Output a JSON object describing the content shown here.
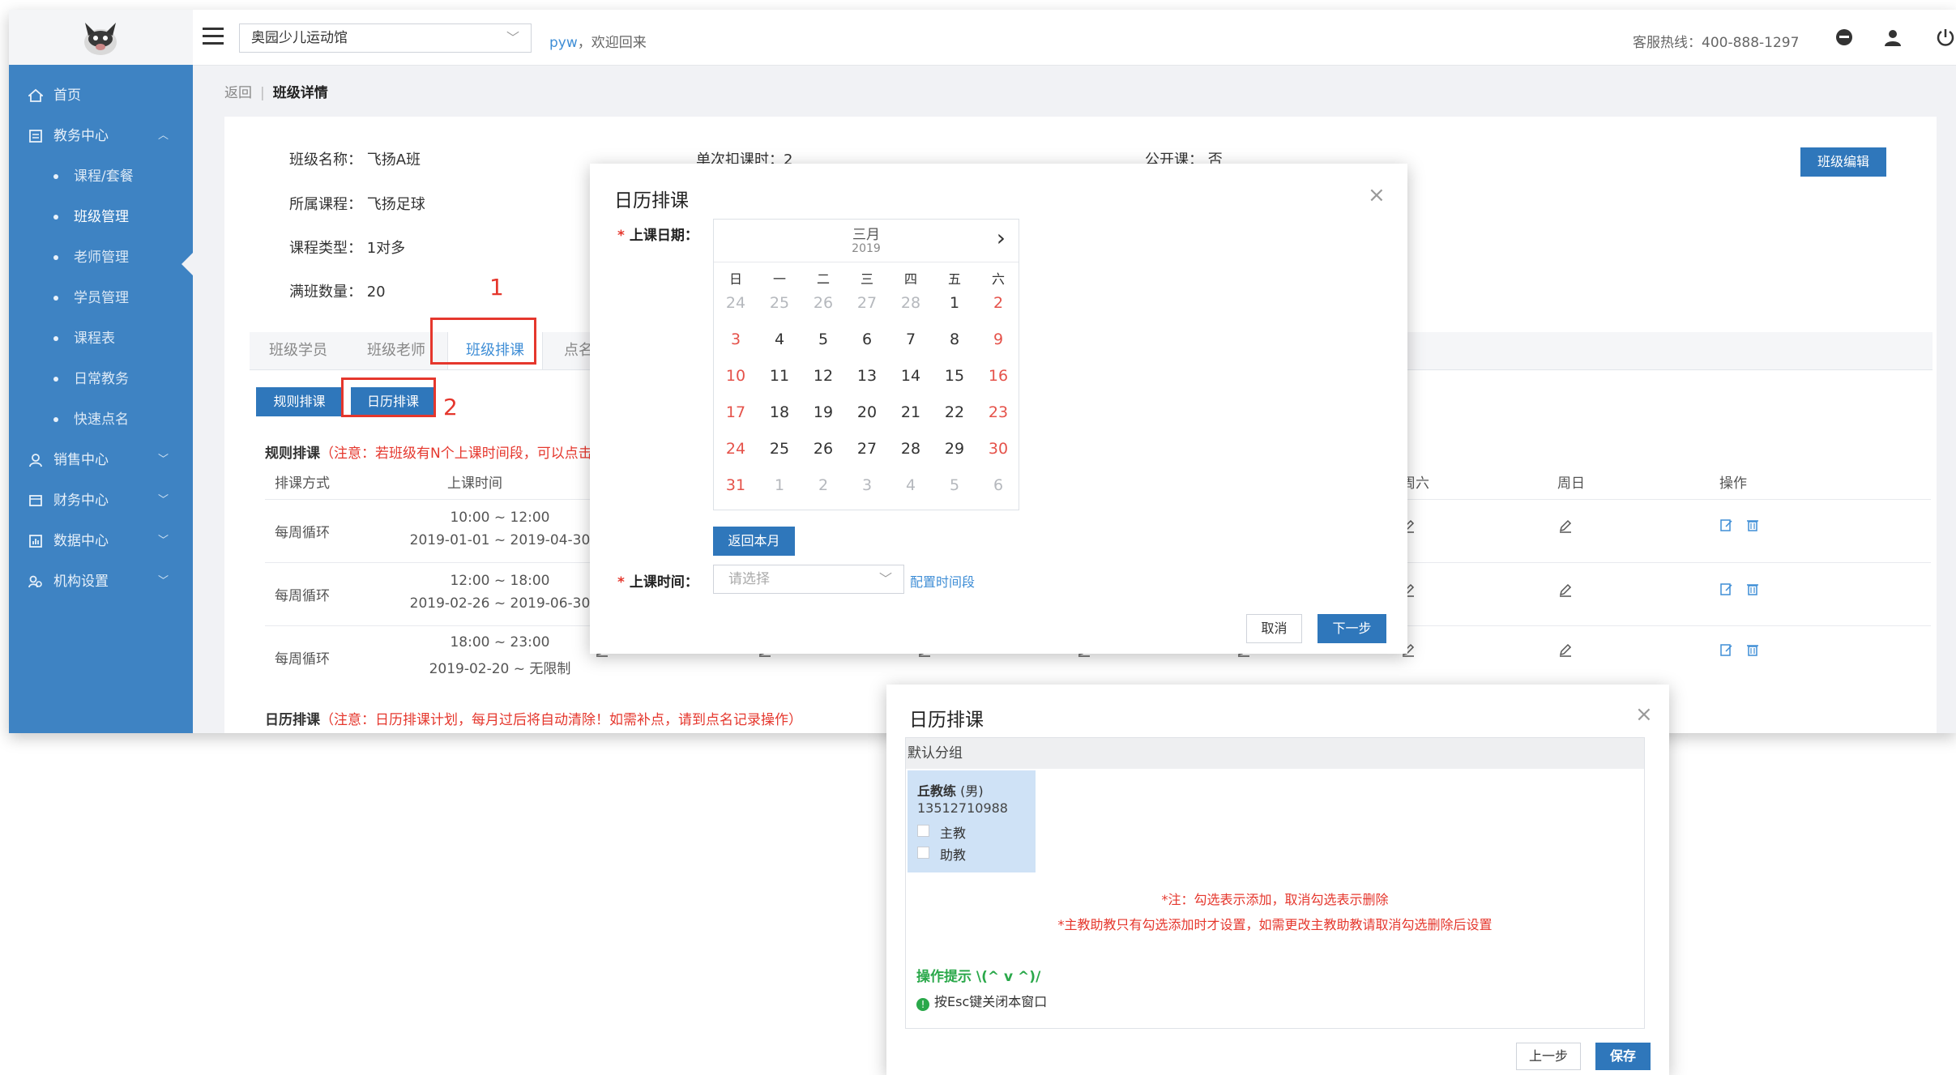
{
  "topbar": {
    "venue": "奥园少儿运动馆",
    "user": "pyw",
    "welcome": "，欢迎回来",
    "hotline": "客服热线：400-888-1297"
  },
  "sidebar": {
    "items": [
      {
        "label": "首页",
        "icon": "home-icon"
      },
      {
        "label": "教务中心",
        "icon": "teaching-icon",
        "chevron": "︿"
      },
      {
        "label": "销售中心",
        "icon": "sales-icon",
        "chevron": "﹀"
      },
      {
        "label": "财务中心",
        "icon": "finance-icon",
        "chevron": "﹀"
      },
      {
        "label": "数据中心",
        "icon": "data-icon",
        "chevron": "﹀"
      },
      {
        "label": "机构设置",
        "icon": "org-icon",
        "chevron": "﹀"
      }
    ],
    "subitems": [
      "课程/套餐",
      "班级管理",
      "老师管理",
      "学员管理",
      "课程表",
      "日常教务",
      "快速点名"
    ]
  },
  "breadcrumb": {
    "back": "返回",
    "sep": "|",
    "current": "班级详情"
  },
  "class_info": {
    "name": "班级名称：  飞扬A班",
    "course": "所属课程：  飞扬足球",
    "type": "课程类型：  1对多",
    "capacity": "满班数量：  20",
    "hidden1": "单次扣课时：2",
    "hidden2": "公开课：  否",
    "edit_button": "班级编辑"
  },
  "annotations": {
    "one": "1",
    "two": "2"
  },
  "tabs": [
    "班级学员",
    "班级老师",
    "班级排课",
    "点名"
  ],
  "sub_buttons": {
    "rule": "规则排课",
    "calendar": "日历排课"
  },
  "rule_note": {
    "label": "规则排课",
    "note": "（注意：若班级有N个上课时间段，可以点击"
  },
  "table": {
    "headers": {
      "mode": "排课方式",
      "time": "上课时间",
      "sat": "周六",
      "sun": "周日",
      "ops": "操作"
    },
    "rows": [
      {
        "mode": "每周循环",
        "time": "10:00 ~ 12:00",
        "dates": "2019-01-01 ~ 2019-04-30"
      },
      {
        "mode": "每周循环",
        "time": "12:00 ~ 18:00",
        "dates": "2019-02-26 ~ 2019-06-30"
      },
      {
        "mode": "每周循环",
        "time": "18:00 ~ 23:00",
        "dates": "2019-02-20 ~ 无限制"
      }
    ]
  },
  "cal_note": {
    "label": "日历排课",
    "note": "（注意：日历排课计划，每月过后将自动清除！如需补点，请到点名记录操作）"
  },
  "dialog1": {
    "title": "日历排课",
    "close": "×",
    "date_label": "上课日期：",
    "time_label": "上课时间：",
    "required": "*",
    "calendar": {
      "month": "三月",
      "year": "2019",
      "next": "›",
      "weekdays": [
        "日",
        "一",
        "二",
        "三",
        "四",
        "五",
        "六"
      ],
      "days": [
        [
          "24",
          "25",
          "26",
          "27",
          "28",
          "1",
          "2"
        ],
        [
          "3",
          "4",
          "5",
          "6",
          "7",
          "8",
          "9"
        ],
        [
          "10",
          "11",
          "12",
          "13",
          "14",
          "15",
          "16"
        ],
        [
          "17",
          "18",
          "19",
          "20",
          "21",
          "22",
          "23"
        ],
        [
          "24",
          "25",
          "26",
          "27",
          "28",
          "29",
          "30"
        ],
        [
          "31",
          "1",
          "2",
          "3",
          "4",
          "5",
          "6"
        ]
      ]
    },
    "back_month": "返回本月",
    "time_placeholder": "请选择",
    "config_link": "配置时间段",
    "cancel": "取消",
    "next": "下一步"
  },
  "dialog2": {
    "title": "日历排课",
    "close": "×",
    "group": "默认分组",
    "coach_name": "丘教练",
    "coach_gender": "(男)",
    "coach_phone": "13512710988",
    "role_main": "主教",
    "role_assist": "助教",
    "note1": "*注：勾选表示添加，取消勾选表示删除",
    "note2": "*主教助教只有勾选添加时才设置，如需更改主教助教请取消勾选删除后设置",
    "tip_title": "操作提示  \\(^ v ^)/",
    "tip_line": "按Esc键关闭本窗口",
    "tip_icon": "!",
    "prev": "上一步",
    "save": "保存"
  },
  "colors": {
    "sidebar": "#3e83c3",
    "primary": "#2f77bb",
    "accent_red": "#e5372d",
    "link": "#3f8ed6",
    "tip_green": "#2aa84a"
  }
}
